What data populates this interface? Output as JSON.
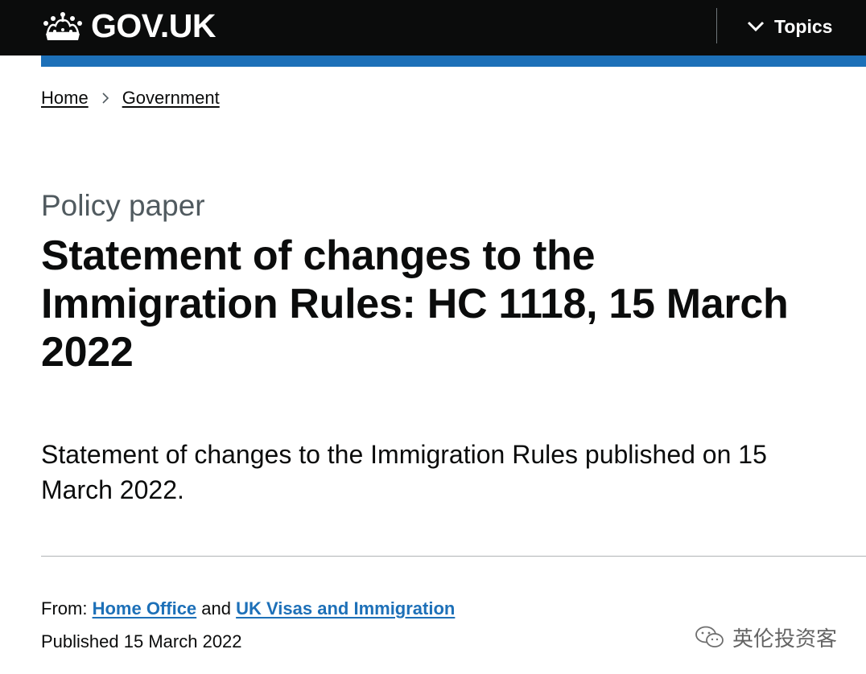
{
  "header": {
    "logo_text": "GOV.UK",
    "topics_label": "Topics",
    "crown_icon": "crown-icon",
    "chevron_icon": "chevron-down-icon"
  },
  "breadcrumb": {
    "items": [
      {
        "label": "Home"
      },
      {
        "label": "Government"
      }
    ],
    "separator_icon": "chevron-right-icon"
  },
  "page": {
    "caption": "Policy paper",
    "title": "Statement of changes to the Immigration Rules: HC 1118, 15 March 2022",
    "lead": "Statement of changes to the Immigration Rules published on 15 March 2022."
  },
  "metadata": {
    "from_label": "From:",
    "org1": "Home Office",
    "and_text": "and",
    "org2": "UK Visas and Immigration",
    "published_label": "Published",
    "published_date": "15 March 2022"
  },
  "watermark": {
    "text": "英伦投资客",
    "icon": "wechat-icon"
  },
  "colors": {
    "header_bg": "#0b0c0c",
    "brand_blue": "#1d70b8",
    "caption_grey": "#505a5f",
    "rule_grey": "#b1b4b6"
  }
}
